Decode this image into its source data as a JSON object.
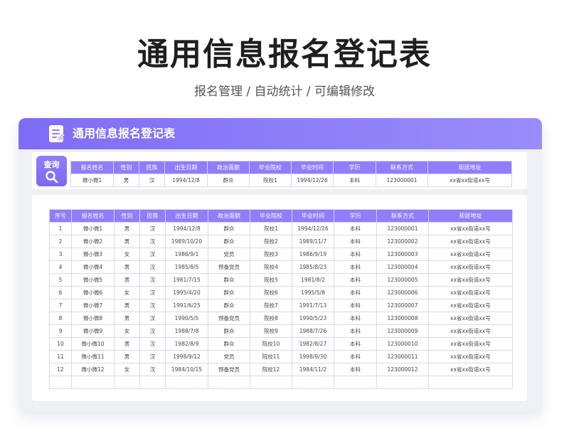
{
  "page": {
    "title": "通用信息报名登记表",
    "subtitle": "报名管理 / 自动统计 /  可编辑修改"
  },
  "card": {
    "title": "通用信息报名登记表",
    "icon": "document-edit-icon",
    "accent_color": "#8f7ef9"
  },
  "query": {
    "button_label": "查询",
    "button_icon": "search-icon",
    "headers": [
      "报名姓名",
      "性别",
      "民族",
      "出生日期",
      "政治面貌",
      "毕业院校",
      "毕业时间",
      "学历",
      "联系方式",
      "现居地址"
    ],
    "row": [
      "微小微1",
      "男",
      "汉",
      "1994/12/8",
      "群众",
      "院校1",
      "1994/12/26",
      "本科",
      "123000001",
      "xx省xx街道xx号"
    ]
  },
  "table": {
    "headers": [
      "序号",
      "报名姓名",
      "性别",
      "民族",
      "出生日期",
      "政治面貌",
      "毕业院校",
      "毕业时间",
      "学历",
      "联系方式",
      "现居地址"
    ],
    "rows": [
      [
        "1",
        "微小微1",
        "男",
        "汉",
        "1994/12/8",
        "群众",
        "院校1",
        "1994/12/26",
        "本科",
        "123000001",
        "xx省xx街道xx号"
      ],
      [
        "2",
        "微小微2",
        "男",
        "汉",
        "1989/10/20",
        "群众",
        "院校2",
        "1989/11/7",
        "本科",
        "123000002",
        "xx省xx街道xx号"
      ],
      [
        "3",
        "微小微3",
        "女",
        "汉",
        "1986/9/1",
        "党员",
        "院校3",
        "1986/9/19",
        "本科",
        "123000003",
        "xx省xx街道xx号"
      ],
      [
        "4",
        "微小微4",
        "男",
        "汉",
        "1985/8/5",
        "预备党员",
        "院校4",
        "1985/8/23",
        "本科",
        "123000004",
        "xx省xx街道xx号"
      ],
      [
        "5",
        "微小微5",
        "男",
        "汉",
        "1981/7/15",
        "群众",
        "院校5",
        "1981/8/2",
        "本科",
        "123000005",
        "xx省xx街道xx号"
      ],
      [
        "6",
        "微小微6",
        "女",
        "汉",
        "1995/4/20",
        "群众",
        "院校6",
        "1995/5/8",
        "本科",
        "123000006",
        "xx省xx街道xx号"
      ],
      [
        "7",
        "微小微7",
        "男",
        "汉",
        "1991/6/25",
        "群众",
        "院校7",
        "1991/7/13",
        "本科",
        "123000007",
        "xx省xx街道xx号"
      ],
      [
        "8",
        "微小微8",
        "男",
        "汉",
        "1990/5/5",
        "预备党员",
        "院校8",
        "1990/5/23",
        "本科",
        "123000008",
        "xx省xx街道xx号"
      ],
      [
        "9",
        "微小微9",
        "女",
        "汉",
        "1988/7/8",
        "群众",
        "院校9",
        "1988/7/26",
        "本科",
        "123000009",
        "xx省xx街道xx号"
      ],
      [
        "10",
        "微小微10",
        "男",
        "汉",
        "1982/8/9",
        "群众",
        "院校10",
        "1982/8/27",
        "本科",
        "123000010",
        "xx省xx街道xx号"
      ],
      [
        "11",
        "微小微11",
        "男",
        "汉",
        "1998/9/12",
        "党员",
        "院校11",
        "1998/9/30",
        "本科",
        "123000011",
        "xx省xx街道xx号"
      ],
      [
        "12",
        "微小微12",
        "女",
        "汉",
        "1984/10/15",
        "预备党员",
        "院校12",
        "1984/11/2",
        "本科",
        "123000012",
        "xx省xx街道xx号"
      ],
      [
        "",
        "",
        "",
        "",
        "",
        "",
        "",
        "",
        "",
        "",
        ""
      ]
    ]
  }
}
